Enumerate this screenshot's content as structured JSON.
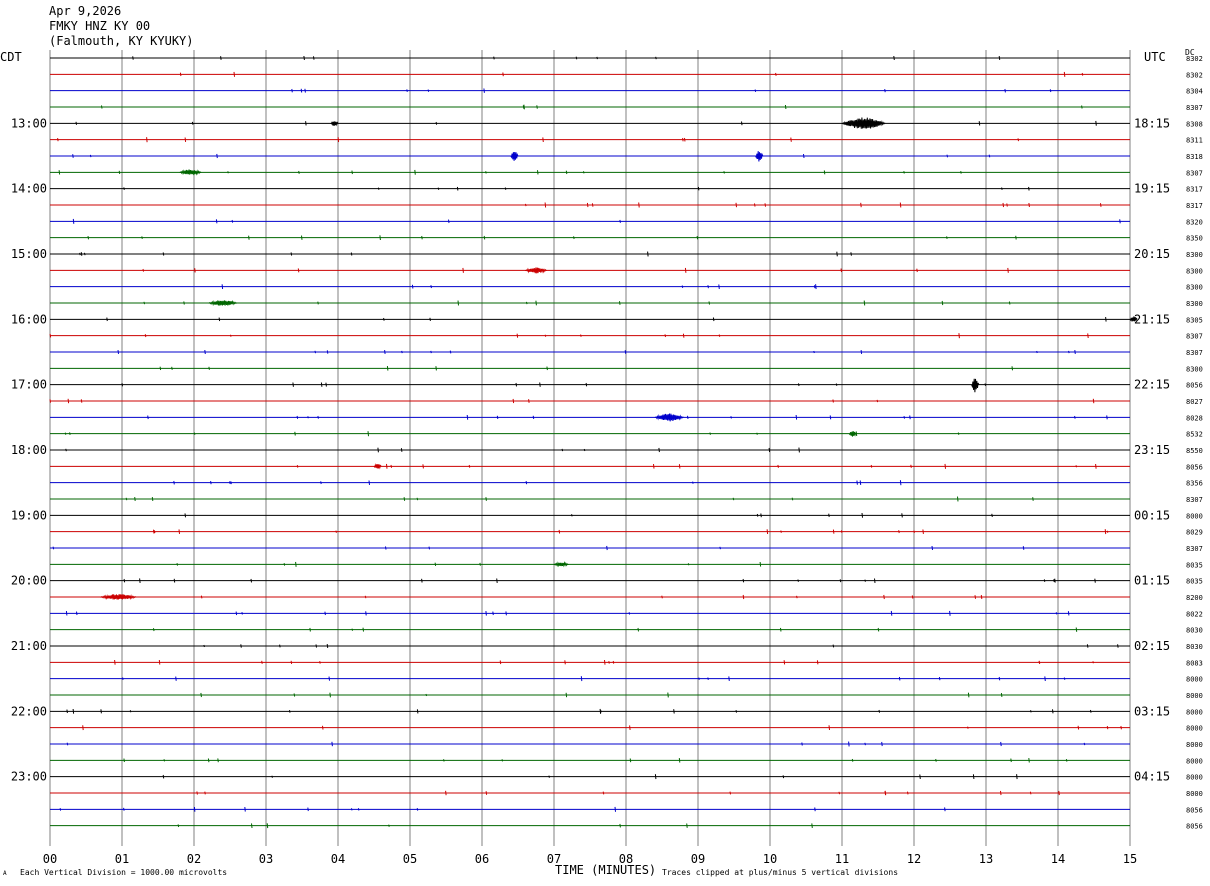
{
  "header": {
    "date": "Apr 9,2026",
    "station": "FMKY HNZ KY 00",
    "location": "(Falmouth, KY KYUKY)"
  },
  "labels": {
    "left_tz": "CDT",
    "right_tz": "UTC",
    "dc_label": "DC",
    "xlabel": "TIME (MINUTES)",
    "scale_note": "Each Vertical Division = 1000.00 microvolts",
    "clip_note": "Traces clipped at plus/minus 5 vertical divisions",
    "corner_mark": "A"
  },
  "colors": {
    "black": "#000000",
    "red": "#cc0000",
    "blue": "#0000cc",
    "green": "#006600",
    "grid": "#808080"
  },
  "chart_data": {
    "type": "line",
    "title": "FMKY HNZ KY 00",
    "xlabel": "TIME (MINUTES)",
    "xlim": [
      0,
      15
    ],
    "x_ticks": [
      "00",
      "01",
      "02",
      "03",
      "04",
      "05",
      "06",
      "07",
      "08",
      "09",
      "10",
      "11",
      "12",
      "13",
      "14",
      "15"
    ],
    "rows_per_hour": 4,
    "trace_colors": [
      "black",
      "red",
      "blue",
      "green"
    ],
    "left_hour_labels": [
      "13:00",
      "14:00",
      "15:00",
      "16:00",
      "17:00",
      "18:00",
      "19:00",
      "20:00",
      "21:00",
      "22:00",
      "23:00"
    ],
    "right_hour_labels": [
      "18:15",
      "19:15",
      "20:15",
      "21:15",
      "22:15",
      "23:15",
      "00:15",
      "01:15",
      "02:15",
      "03:15",
      "04:15"
    ],
    "dc_offsets": [
      "8302",
      "8302",
      "8304",
      "8307",
      "8308",
      "8311",
      "8318",
      "8307",
      "8317",
      "8317",
      "8320",
      "8350",
      "8300",
      "8300",
      "8300",
      "8300",
      "8305",
      "8307",
      "8307",
      "8300",
      "8056",
      "8027",
      "8028",
      "8532",
      "8550",
      "8056",
      "8356",
      "8307",
      "8000",
      "8029",
      "8307",
      "8035",
      "8035",
      "8200",
      "8022",
      "8030",
      "8030",
      "8083",
      "8000",
      "8000",
      "8000",
      "8000",
      "8000",
      "8000",
      "8000",
      "8000",
      "8056",
      "8056"
    ],
    "events": [
      {
        "row": 4,
        "minute": 11.0,
        "duration": 0.6,
        "amplitude": 6
      },
      {
        "row": 4,
        "minute": 3.9,
        "duration": 0.1,
        "amplitude": 3
      },
      {
        "row": 6,
        "minute": 6.4,
        "duration": 0.1,
        "amplitude": 5
      },
      {
        "row": 6,
        "minute": 9.8,
        "duration": 0.1,
        "amplitude": 6
      },
      {
        "row": 7,
        "minute": 1.8,
        "duration": 0.3,
        "amplitude": 3
      },
      {
        "row": 13,
        "minute": 6.6,
        "duration": 0.3,
        "amplitude": 3
      },
      {
        "row": 15,
        "minute": 2.2,
        "duration": 0.4,
        "amplitude": 3
      },
      {
        "row": 16,
        "minute": 15.0,
        "duration": 0.1,
        "amplitude": 3
      },
      {
        "row": 20,
        "minute": 12.8,
        "duration": 0.1,
        "amplitude": 8
      },
      {
        "row": 22,
        "minute": 8.4,
        "duration": 0.4,
        "amplitude": 4
      },
      {
        "row": 23,
        "minute": 11.1,
        "duration": 0.1,
        "amplitude": 3
      },
      {
        "row": 25,
        "minute": 4.5,
        "duration": 0.1,
        "amplitude": 3
      },
      {
        "row": 31,
        "minute": 7.0,
        "duration": 0.2,
        "amplitude": 2
      },
      {
        "row": 33,
        "minute": 0.7,
        "duration": 0.5,
        "amplitude": 3
      }
    ]
  }
}
